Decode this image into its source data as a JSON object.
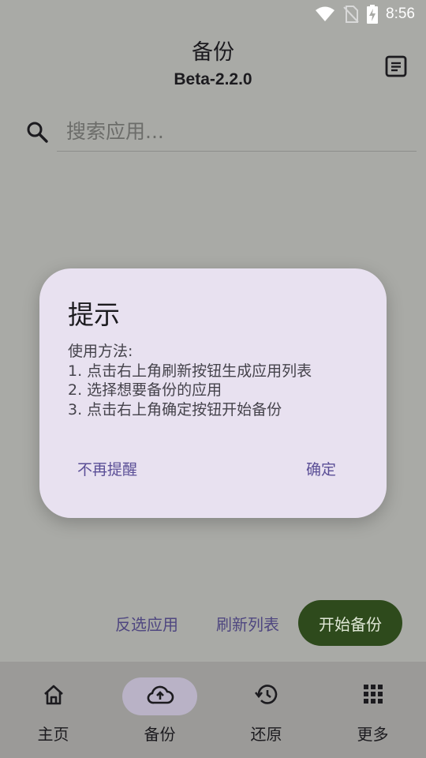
{
  "status_bar": {
    "time": "8:56"
  },
  "header": {
    "title": "备份",
    "subtitle": "Beta-2.2.0"
  },
  "search": {
    "placeholder": "搜索应用..."
  },
  "dialog": {
    "title": "提示",
    "lines": [
      "使用方法:",
      "1. 点击右上角刷新按钮生成应用列表",
      "2. 选择想要备份的应用",
      "3. 点击右上角确定按钮开始备份"
    ],
    "dismiss_label": "不再提醒",
    "confirm_label": "确定"
  },
  "actions": {
    "invert_label": "反选应用",
    "refresh_label": "刷新列表",
    "start_label": "开始备份"
  },
  "nav": {
    "items": [
      {
        "label": "主页",
        "icon": "home-icon"
      },
      {
        "label": "备份",
        "icon": "cloud-upload-icon"
      },
      {
        "label": "还原",
        "icon": "history-icon"
      },
      {
        "label": "更多",
        "icon": "apps-grid-icon"
      }
    ],
    "active_index": 1
  },
  "colors": {
    "scrim": "#a9aaa6",
    "dialog_bg": "#e8e1f0",
    "accent_text": "#5a4e96",
    "primary_button": "#2e4a1c"
  }
}
